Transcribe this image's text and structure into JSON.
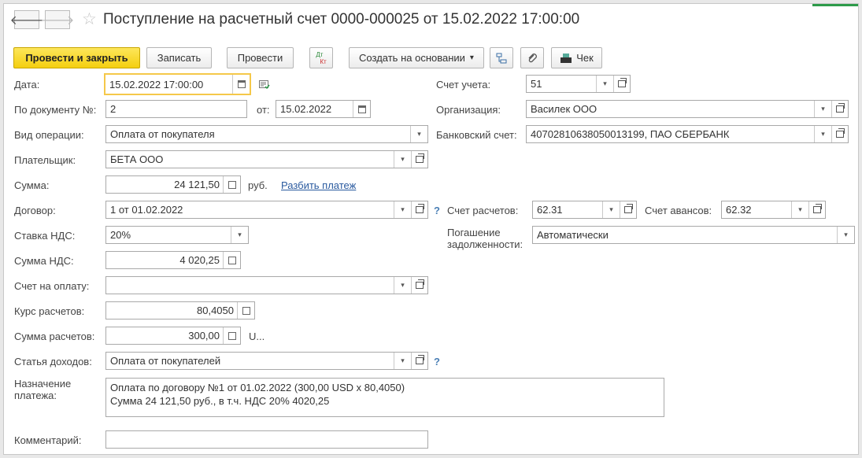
{
  "header": {
    "back": "🡐",
    "forward": "🡒",
    "star": "☆",
    "title": "Поступление на расчетный счет 0000-000025 от 15.02.2022 17:00:00"
  },
  "toolbar": {
    "post_close": "Провести и закрыть",
    "save": "Записать",
    "post": "Провести",
    "dtkt_top": "Дт",
    "dtkt_bottom": "Кт",
    "create_based": "Создать на основании",
    "cheque": "Чек"
  },
  "form": {
    "date_label": "Дата:",
    "date_value": "15.02.2022 17:00:00",
    "doc_no_label": "По документу №:",
    "doc_no_value": "2",
    "from_label": "от:",
    "from_value": "15.02.2022",
    "op_type_label": "Вид операции:",
    "op_type_value": "Оплата от покупателя",
    "payer_label": "Плательщик:",
    "payer_value": "БЕТА ООО",
    "amount_label": "Сумма:",
    "amount_value": "24 121,50",
    "amount_currency": "руб.",
    "split_link": "Разбить платеж",
    "contract_label": "Договор:",
    "contract_value": "1 от 01.02.2022",
    "vat_rate_label": "Ставка НДС:",
    "vat_rate_value": "20%",
    "vat_amount_label": "Сумма НДС:",
    "vat_amount_value": "4 020,25",
    "invoice_label": "Счет на оплату:",
    "invoice_value": "",
    "rate_label": "Курс расчетов:",
    "rate_value": "80,4050",
    "settle_amount_label": "Сумма расчетов:",
    "settle_amount_value": "300,00",
    "settle_currency": "U...",
    "income_item_label": "Статья доходов:",
    "income_item_value": "Оплата от покупателей",
    "purpose_label_1": "Назначение",
    "purpose_label_2": "платежа:",
    "purpose_line_1": "Оплата по договору №1 от 01.02.2022 (300,00 USD х 80,4050)",
    "purpose_line_2": "Сумма 24 121,50 руб., в т.ч. НДС 20% 4020,25",
    "comment_label": "Комментарий:",
    "comment_value": "",
    "account_label": "Счет учета:",
    "account_value": "51",
    "org_label": "Организация:",
    "org_value": "Василек ООО",
    "bank_label": "Банковский счет:",
    "bank_value": "40702810638050013199, ПАО СБЕРБАНК",
    "settle_acc_label": "Счет расчетов:",
    "settle_acc_value": "62.31",
    "advance_acc_label": "Счет авансов:",
    "advance_acc_value": "62.32",
    "repay_label_1": "Погашение",
    "repay_label_2": "задолженности:",
    "repay_value": "Автоматически",
    "help_mark": "?",
    "dropdown_glyph": "▾"
  },
  "colors": {
    "primary_button": "#f4cf10",
    "focus_border": "#f5c84a",
    "link": "#2a5a9f"
  }
}
